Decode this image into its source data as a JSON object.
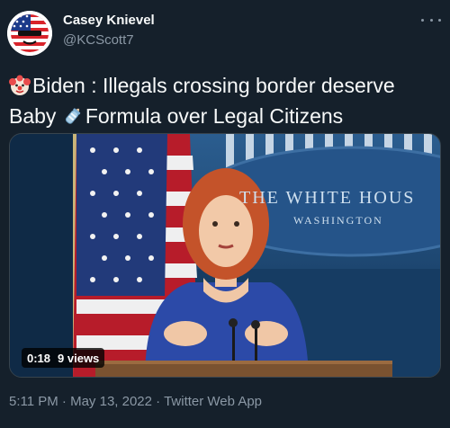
{
  "user": {
    "name": "Casey Knievel",
    "handle": "@KCScott7"
  },
  "tweet": {
    "line1": "Biden : Illegals crossing border deserve",
    "line2_part1": "Baby ",
    "line2_part2": "Formula over Legal Citizens",
    "emoji_1": "clown-face-icon",
    "emoji_2": "baby-bottle-icon"
  },
  "video": {
    "duration": "0:18",
    "views": "9 views",
    "backdrop_line1": "THE WHITE HOUS",
    "backdrop_line2": "WASHINGTON"
  },
  "meta": {
    "time": "5:11 PM",
    "separator": " · ",
    "date": "May 13, 2022",
    "app": "Twitter Web App"
  },
  "colors": {
    "background": "#15202b",
    "text_primary": "#f7f9f9",
    "text_secondary": "#8b98a5",
    "border": "#38444d"
  }
}
